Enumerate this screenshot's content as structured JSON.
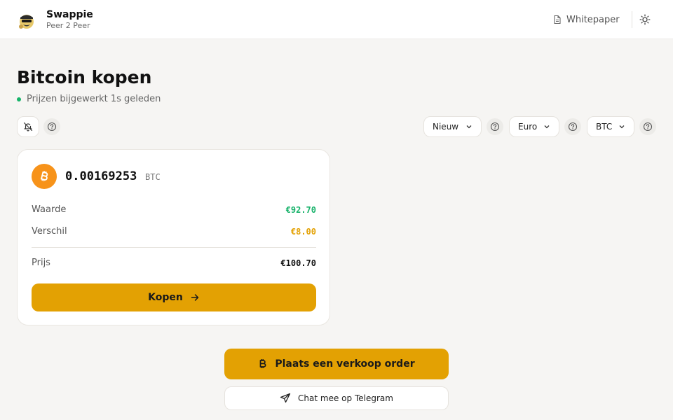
{
  "header": {
    "brand_name": "Swappie",
    "brand_tagline": "Peer 2 Peer",
    "whitepaper_label": "Whitepaper",
    "logo_icon": "avatar-logo-icon",
    "theme_icon": "sun-icon"
  },
  "page": {
    "title": "Bitcoin kopen",
    "status_text": "Prijzen bijgewerkt 1s geleden",
    "status_color": "#16b46a"
  },
  "filters": {
    "sort_label": "Nieuw",
    "currency_label": "Euro",
    "asset_label": "BTC"
  },
  "offer": {
    "amount": "0.00169253",
    "unit": "BTC",
    "waarde_label": "Waarde",
    "waarde_value": "€92.70",
    "waarde_color": "#17b26a",
    "verschil_label": "Verschil",
    "verschil_value": "€8.00",
    "verschil_color": "#e3a103",
    "prijs_label": "Prijs",
    "prijs_value": "€100.70",
    "buy_label": "Kopen"
  },
  "actions": {
    "sell_label": "Plaats een verkoop order",
    "telegram_label": "Chat mee op Telegram"
  },
  "colors": {
    "accent": "#e3a103",
    "bitcoin": "#f7931a",
    "background": "#f6f5f3"
  }
}
